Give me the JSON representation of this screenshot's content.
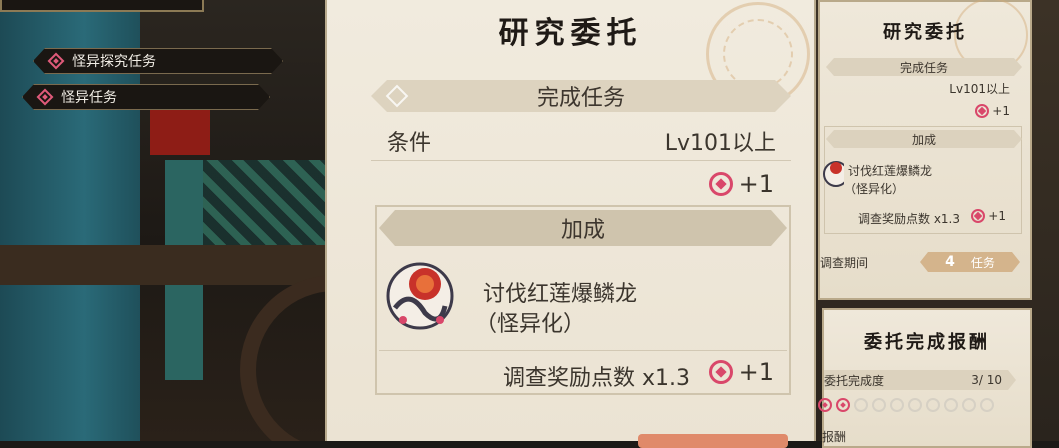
{
  "left_menu": {
    "items": [
      {
        "label": "怪异探究任务"
      },
      {
        "label": "怪异任务"
      }
    ]
  },
  "request_panel": {
    "title": "研究委托",
    "complete_section": "完成任务",
    "condition_label": "条件",
    "condition_value": "Lv101以上",
    "complete_reward": "+1",
    "bonus_section": "加成",
    "target_name": "讨伐红莲爆鳞龙",
    "target_variant": "（怪异化）",
    "bonus_label": "调查奖励点数 x1.3",
    "bonus_reward": "+1",
    "icons": {
      "point": "research-point-icon",
      "monster": "crimson-glow-valstrax-icon"
    }
  },
  "side_panel": {
    "title": "研究委托",
    "complete_section": "完成任务",
    "condition_value": "Lv101以上",
    "complete_reward": "+1",
    "bonus_section": "加成",
    "target_name": "讨伐红莲爆鳞龙",
    "target_variant": "（怪异化）",
    "bonus_label": "调查奖励点数 x1.3",
    "bonus_reward": "+1",
    "period_label": "调查期间",
    "period_value": "4",
    "period_unit": "任务"
  },
  "reward_panel": {
    "title": "委托完成报酬",
    "progress_label": "委托完成度",
    "progress_value": "3/ 10",
    "progress_filled": 2,
    "progress_total": 10,
    "last_label": "报酬"
  },
  "colors": {
    "accent": "#d9476a",
    "parchment": "#efe8da",
    "band": "#ddd3bf"
  }
}
